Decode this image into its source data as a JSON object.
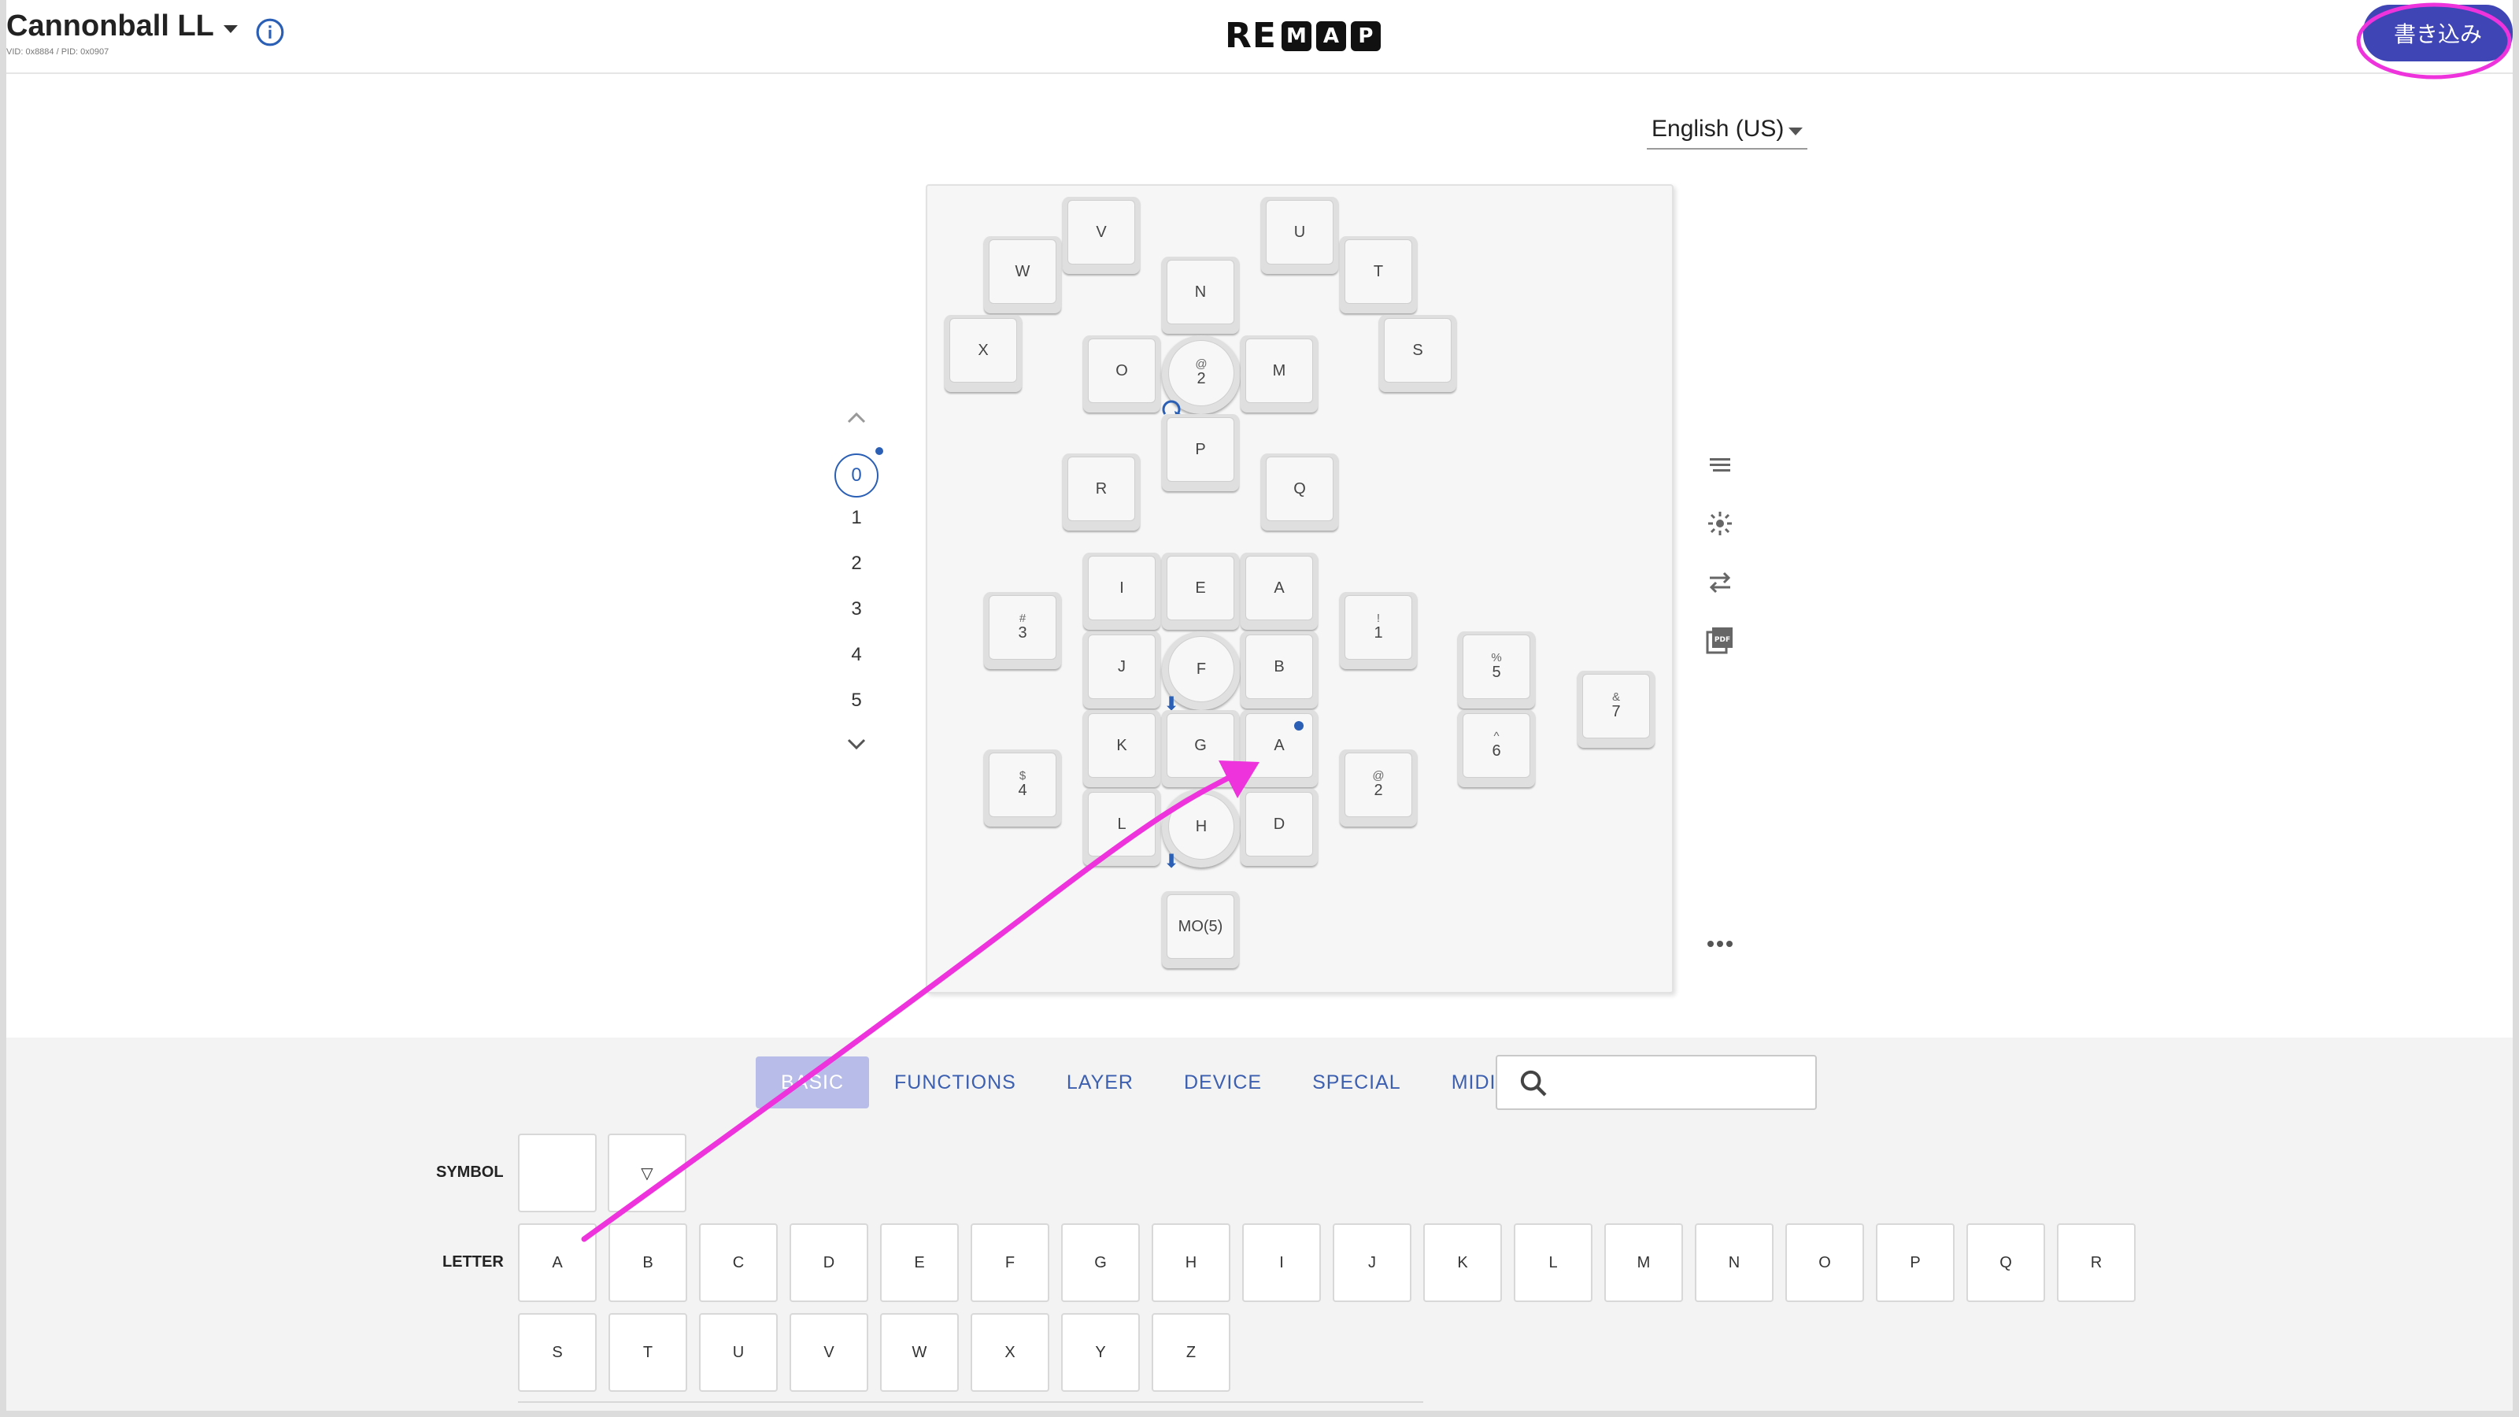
{
  "header": {
    "keyboard_name": "Cannonball LL",
    "ids": "VID: 0x8884 / PID: 0x0907",
    "logo_prefix": "RE",
    "logo_boxes": [
      "M",
      "A",
      "P"
    ],
    "write_label": "書き込み"
  },
  "language": {
    "selected": "English (US)"
  },
  "layers": {
    "items": [
      "0",
      "1",
      "2",
      "3",
      "4",
      "5"
    ],
    "active": "0"
  },
  "keymap": {
    "k_v": "V",
    "k_u": "U",
    "k_w": "W",
    "k_t": "T",
    "k_n": "N",
    "k_x": "X",
    "k_s": "S",
    "k_o": "O",
    "k_enc1_sub": "@",
    "k_enc1": "2",
    "k_m": "M",
    "k_p": "P",
    "k_r": "R",
    "k_q": "Q",
    "k_i": "I",
    "k_e": "E",
    "k_a1": "A",
    "k_hash_sub": "#",
    "k_3": "3",
    "k_excl_sub": "!",
    "k_1": "1",
    "k_pct_sub": "%",
    "k_5": "5",
    "k_amp_sub": "&",
    "k_7": "7",
    "k_j": "J",
    "k_f": "F",
    "k_b": "B",
    "k_caret_sub": "^",
    "k_6": "6",
    "k_k": "K",
    "k_g": "G",
    "k_a2": "A",
    "k_dollar_sub": "$",
    "k_4": "4",
    "k_at_sub": "@",
    "k_2": "2",
    "k_l": "L",
    "k_h": "H",
    "k_d": "D",
    "k_mo": "MO(5)"
  },
  "tabs": [
    "BASIC",
    "FUNCTIONS",
    "LAYER",
    "DEVICE",
    "SPECIAL",
    "MIDI"
  ],
  "active_tab": "BASIC",
  "search": {
    "placeholder": ""
  },
  "keycodes": {
    "symbol_label": "SYMBOL",
    "symbol_keys": [
      "",
      "▽"
    ],
    "letter_label": "LETTER",
    "letters_row1": [
      "A",
      "B",
      "C",
      "D",
      "E",
      "F",
      "G",
      "H",
      "I",
      "J",
      "K",
      "L",
      "M",
      "N",
      "O",
      "P",
      "Q",
      "R"
    ],
    "letters_row2": [
      "S",
      "T",
      "U",
      "V",
      "W",
      "X",
      "Y",
      "Z"
    ]
  },
  "colors": {
    "accent": "#3f45b5",
    "annotation": "#ee33dd",
    "link": "#3c5fb0"
  }
}
